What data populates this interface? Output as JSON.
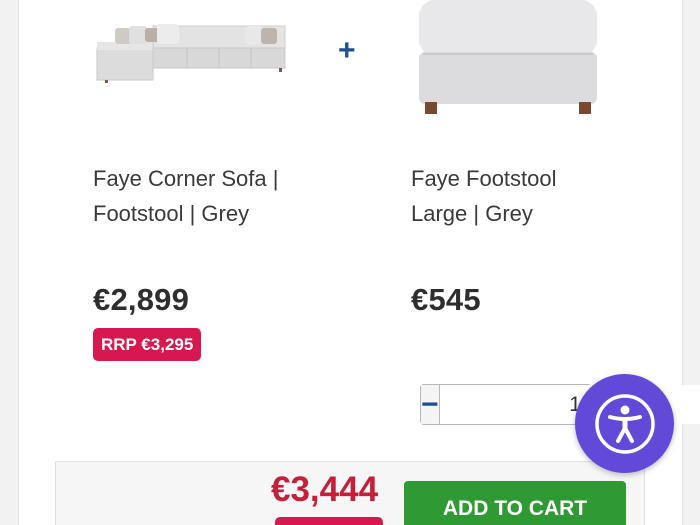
{
  "bundle": {
    "plus_symbol": "+",
    "products": [
      {
        "name_line1": "Faye Corner Sofa |",
        "name_line2": "Footstool | Grey",
        "price": "€2,899",
        "rrp": "RRP €3,295",
        "image_icon": "corner-sofa-image"
      },
      {
        "name_line1": "Faye Footstool",
        "name_line2": "Large | Grey",
        "price": "€545",
        "image_icon": "footstool-image"
      }
    ],
    "quantity": {
      "minus_label": "−",
      "value": "1",
      "plus_label": "+"
    }
  },
  "summary": {
    "total": "€3,444",
    "add_to_cart_label": "ADD TO CART"
  },
  "accessibility": {
    "icon": "accessibility-person-icon"
  },
  "colors": {
    "price_red": "#c4203a",
    "badge_pink": "#d6184f",
    "cart_green": "#2f9a33",
    "quantity_blue": "#1f4f8f",
    "accessibility_purple": "#6349d8"
  }
}
